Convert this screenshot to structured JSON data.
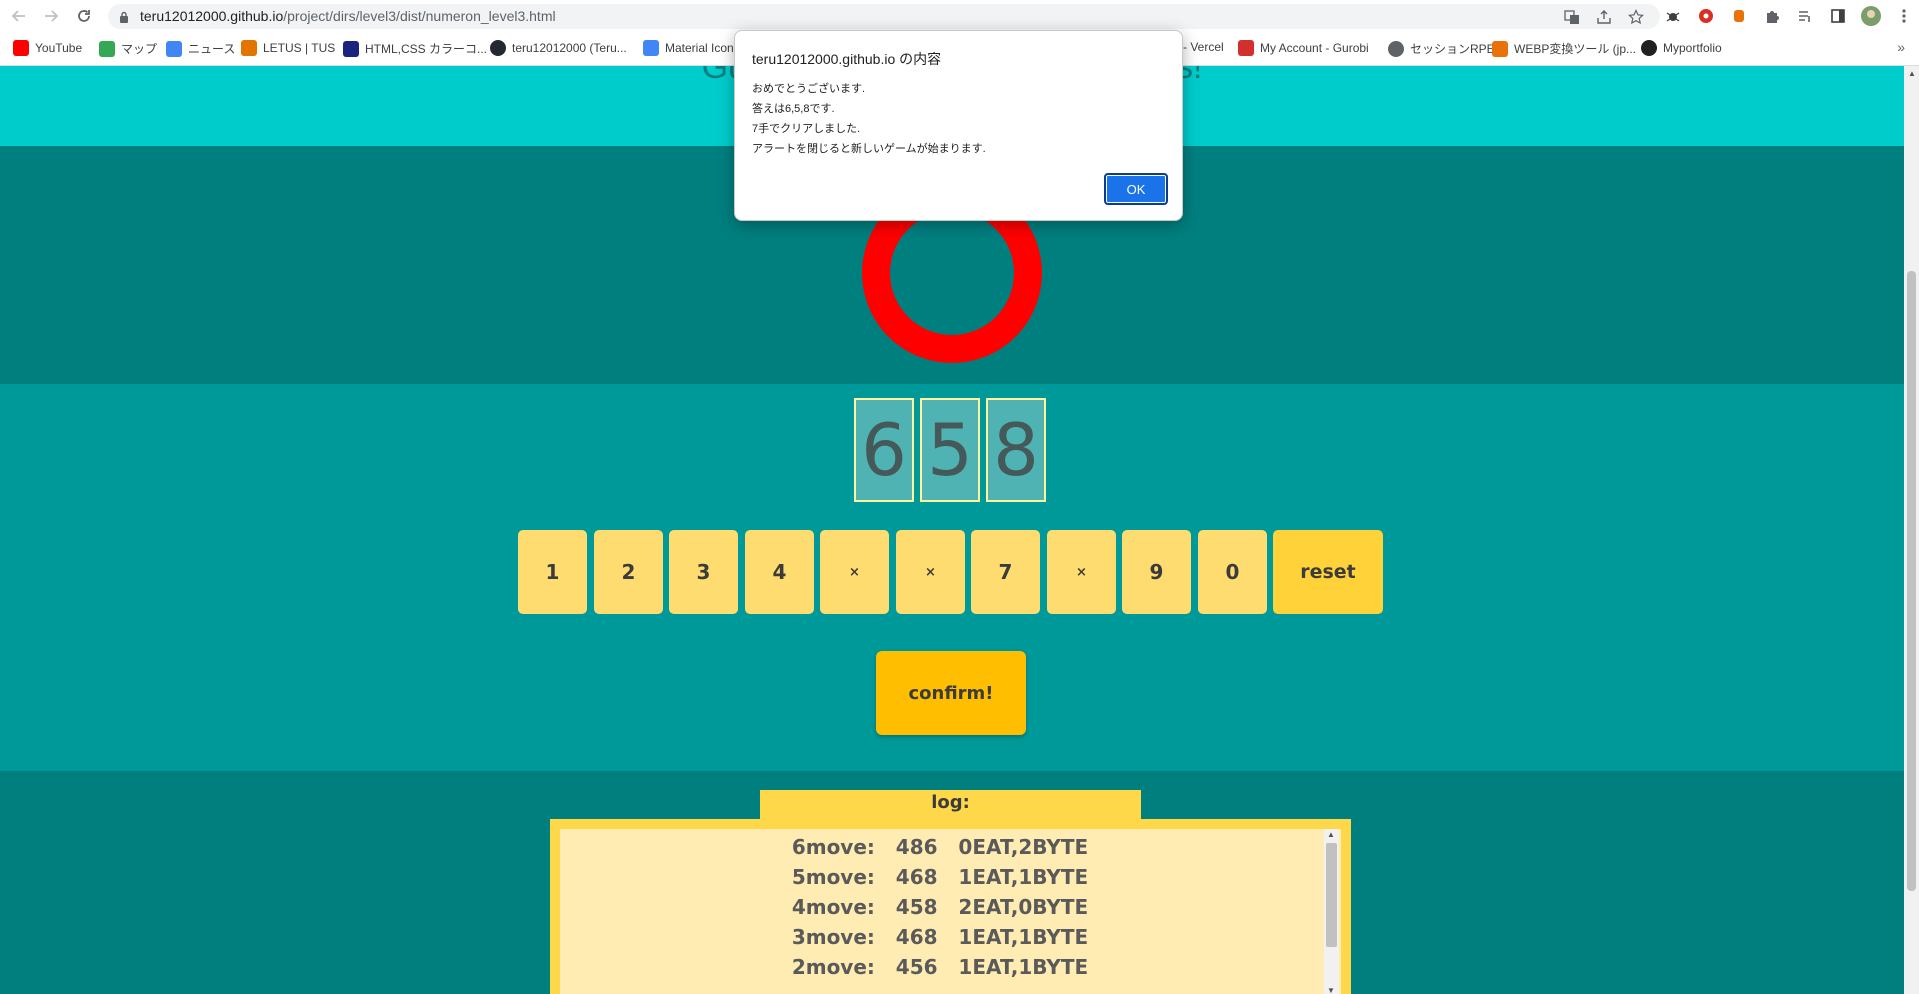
{
  "browser": {
    "url_host": "teru12012000.github.io",
    "url_path": "/project/dirs/level3/dist/numeron_level3.html",
    "bookmarks": [
      {
        "label": "YouTube",
        "color": "#ff0000"
      },
      {
        "label": "マップ",
        "color": "#34a853"
      },
      {
        "label": "ニュース",
        "color": "#4285f4"
      },
      {
        "label": "LETUS | TUS",
        "color": "#e37400"
      },
      {
        "label": "HTML,CSS カラーコ...",
        "color": "#1a237e"
      },
      {
        "label": "teru12012000 (Teru...",
        "color": "#24292f"
      },
      {
        "label": "Material Icon",
        "color": "#4285f4"
      },
      {
        "label": "- Vercel",
        "color": "#000000"
      },
      {
        "label": "My Account - Gurobi",
        "color": "#d32f2f"
      },
      {
        "label": "セッションRPE",
        "color": "#5f6368"
      },
      {
        "label": "WEBP変換ツール (jp...",
        "color": "#e8710a"
      },
      {
        "label": "Myportfolio",
        "color": "#202124"
      }
    ]
  },
  "page": {
    "heading": "Guess the number in three digits!"
  },
  "game": {
    "slots": [
      "6",
      "5",
      "8"
    ],
    "keys": [
      "1",
      "2",
      "3",
      "4",
      "×",
      "×",
      "7",
      "×",
      "9",
      "0"
    ],
    "reset_label": "reset",
    "confirm_label": "confirm!",
    "colors": {
      "circle": "#ff0000",
      "key": "#ffdc70",
      "confirm": "#ffbf00"
    }
  },
  "log": {
    "title": "log:",
    "entries": [
      "6move:   486   0EAT,2BYTE",
      "5move:   468   1EAT,1BYTE",
      "4move:   458   2EAT,0BYTE",
      "3move:   468   1EAT,1BYTE",
      "2move:   456   1EAT,1BYTE"
    ]
  },
  "dialog": {
    "title": "teru12012000.github.io の内容",
    "lines": [
      "おめでとうございます.",
      "答えは6,5,8です.",
      "7手でクリアしました.",
      "アラートを閉じると新しいゲームが始まります."
    ],
    "ok_label": "OK"
  }
}
